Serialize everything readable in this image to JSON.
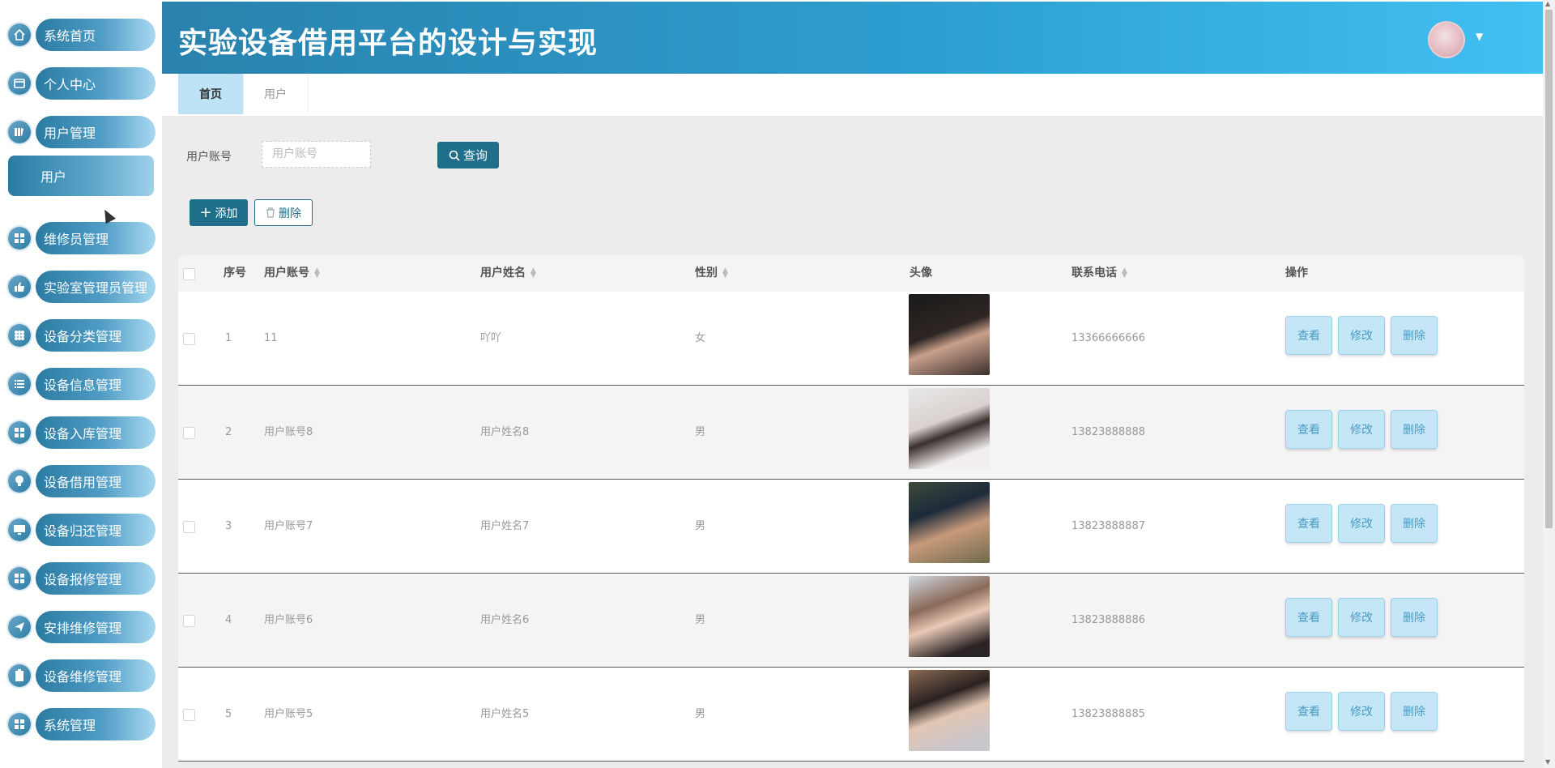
{
  "app": {
    "title": "实验设备借用平台的设计与实现"
  },
  "sidebar": {
    "items": [
      {
        "label": "系统首页",
        "icon": "home-icon"
      },
      {
        "label": "个人中心",
        "icon": "profile-card-icon"
      },
      {
        "label": "用户管理",
        "icon": "book-icon"
      },
      {
        "label": "维修员管理",
        "icon": "grid-icon"
      },
      {
        "label": "实验室管理员管理",
        "icon": "thumb-up-icon"
      },
      {
        "label": "设备分类管理",
        "icon": "grid-icon"
      },
      {
        "label": "设备信息管理",
        "icon": "list-icon"
      },
      {
        "label": "设备入库管理",
        "icon": "grid-icon"
      },
      {
        "label": "设备借用管理",
        "icon": "bulb-icon"
      },
      {
        "label": "设备归还管理",
        "icon": "monitor-icon"
      },
      {
        "label": "设备报修管理",
        "icon": "grid-icon"
      },
      {
        "label": "安排维修管理",
        "icon": "send-icon"
      },
      {
        "label": "设备维修管理",
        "icon": "clipboard-icon"
      },
      {
        "label": "系统管理",
        "icon": "grid-icon"
      }
    ],
    "active_sub": "用户"
  },
  "tabs": [
    {
      "label": "首页",
      "active": true
    },
    {
      "label": "用户",
      "active": false
    }
  ],
  "search": {
    "label": "用户账号",
    "placeholder": "用户账号",
    "button": "查询"
  },
  "actions": {
    "add": "添加",
    "delete": "删除"
  },
  "table": {
    "headers": {
      "index": "序号",
      "account": "用户账号",
      "name": "用户姓名",
      "gender": "性别",
      "avatar": "头像",
      "phone": "联系电话",
      "ops": "操作"
    },
    "rows": [
      {
        "index": "1",
        "account": "11",
        "name": "吖吖",
        "gender": "女",
        "phone": "13366666666"
      },
      {
        "index": "2",
        "account": "用户账号8",
        "name": "用户姓名8",
        "gender": "男",
        "phone": "13823888888"
      },
      {
        "index": "3",
        "account": "用户账号7",
        "name": "用户姓名7",
        "gender": "男",
        "phone": "13823888887"
      },
      {
        "index": "4",
        "account": "用户账号6",
        "name": "用户姓名6",
        "gender": "男",
        "phone": "13823888886"
      },
      {
        "index": "5",
        "account": "用户账号5",
        "name": "用户姓名5",
        "gender": "男",
        "phone": "13823888885"
      }
    ],
    "row_ops": {
      "view": "查看",
      "edit": "修改",
      "delete": "删除"
    }
  }
}
